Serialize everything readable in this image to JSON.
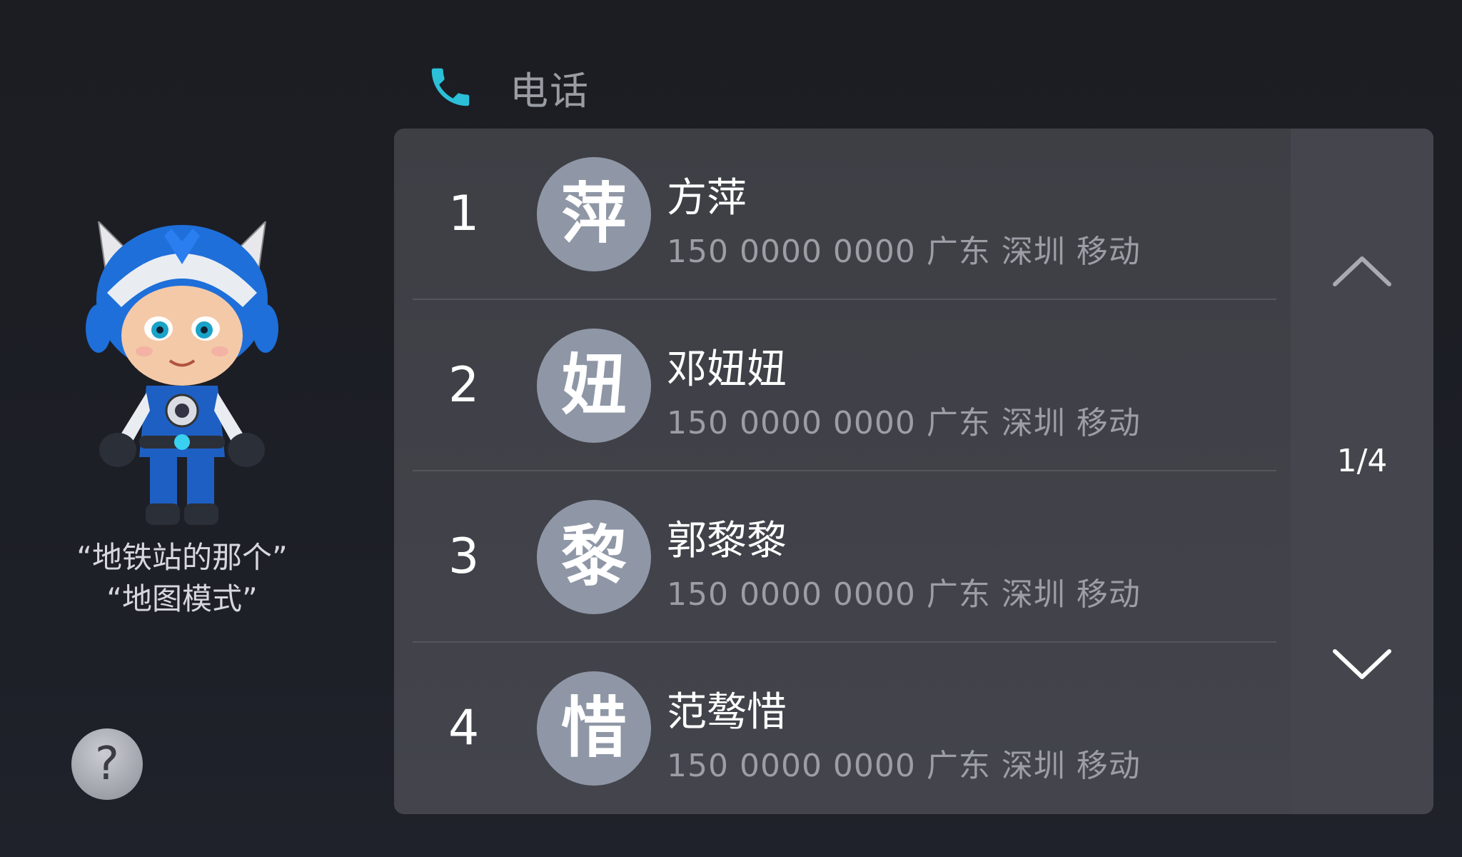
{
  "header": {
    "title": "电话",
    "icon": "phone-icon",
    "accent_color": "#2bc0d8"
  },
  "assistant": {
    "icon": "robot-mascot-icon",
    "hints": [
      "“地铁站的那个”",
      "“地图模式”"
    ]
  },
  "help": {
    "label": "?",
    "icon": "question-icon"
  },
  "contacts": [
    {
      "index": "1",
      "avatar": "萍",
      "name": "方萍",
      "detail": "150 0000 0000  广东 深圳 移动"
    },
    {
      "index": "2",
      "avatar": "妞",
      "name": "邓妞妞",
      "detail": "150 0000 0000  广东 深圳 移动"
    },
    {
      "index": "3",
      "avatar": "黎",
      "name": "郭黎黎",
      "detail": "150 0000 0000  广东 深圳 移动"
    },
    {
      "index": "4",
      "avatar": "惜",
      "name": "范骜惜",
      "detail": "150 0000 0000  广东 深圳 移动"
    }
  ],
  "pager": {
    "page": "1/4",
    "up_icon": "chevron-up-icon",
    "down_icon": "chevron-down-icon"
  },
  "colors": {
    "avatar_bg": "#8f97a6",
    "panel_bg": "#3e3f45",
    "muted_text": "#9c9ea6"
  }
}
